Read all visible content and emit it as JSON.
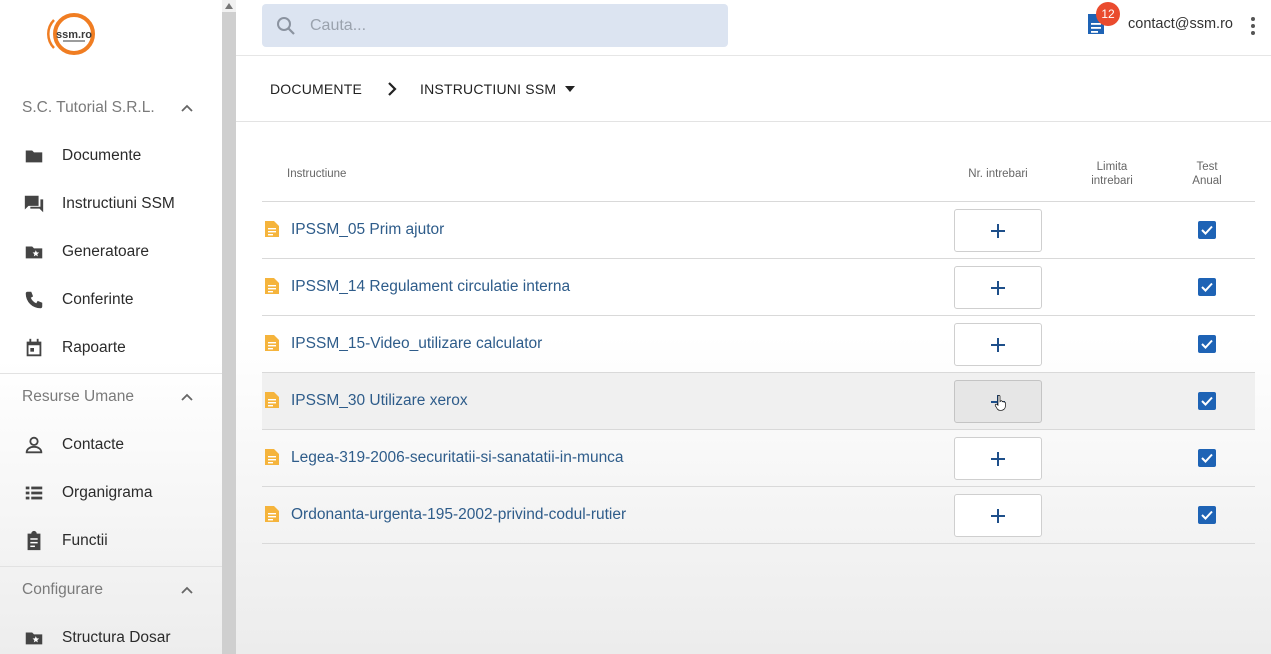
{
  "brand": {
    "logo_text": "ssm.ro",
    "logo_color": "#f07d22"
  },
  "sidebar": {
    "groups": [
      {
        "title": "S.C. Tutorial S.R.L.",
        "items": [
          {
            "label": "Documente",
            "icon": "folder-icon"
          },
          {
            "label": "Instructiuni SSM",
            "icon": "forum-icon"
          },
          {
            "label": "Generatoare",
            "icon": "folder-star-icon"
          },
          {
            "label": "Conferinte",
            "icon": "phone-icon"
          },
          {
            "label": "Rapoarte",
            "icon": "calendar-icon"
          }
        ]
      },
      {
        "title": "Resurse Umane",
        "items": [
          {
            "label": "Contacte",
            "icon": "person-icon"
          },
          {
            "label": "Organigrama",
            "icon": "list-icon"
          },
          {
            "label": "Functii",
            "icon": "clipboard-icon"
          }
        ]
      },
      {
        "title": "Configurare",
        "items": [
          {
            "label": "Structura Dosar",
            "icon": "folder-star-icon"
          }
        ]
      }
    ]
  },
  "topbar": {
    "search_placeholder": "Cauta...",
    "notification_count": "12",
    "user_email": "contact@ssm.ro"
  },
  "breadcrumb": {
    "root": "DOCUMENTE",
    "current": "INSTRUCTIUNI SSM"
  },
  "table": {
    "headers": {
      "instructiune": "Instructiune",
      "nr_intrebari": "Nr. intrebari",
      "limita_line1": "Limita",
      "limita_line2": "intrebari",
      "test_line1": "Test",
      "test_line2": "Anual"
    },
    "rows": [
      {
        "name": "IPSSM_05 Prim ajutor",
        "test_anual": true
      },
      {
        "name": "IPSSM_14 Regulament circulatie interna",
        "test_anual": true
      },
      {
        "name": "IPSSM_15-Video_utilizare calculator",
        "test_anual": true
      },
      {
        "name": "IPSSM_30 Utilizare xerox",
        "test_anual": true
      },
      {
        "name": "Legea-319-2006-securitatii-si-sanatatii-in-munca",
        "test_anual": true
      },
      {
        "name": "Ordonanta-urgenta-195-2002-privind-codul-rutier",
        "test_anual": true
      }
    ]
  },
  "colors": {
    "link": "#2e5c8a",
    "checkbox": "#1e63b5",
    "badge": "#ea4b2e",
    "search_bg": "#dce4f1",
    "doc_icon": "#f5b43c"
  }
}
